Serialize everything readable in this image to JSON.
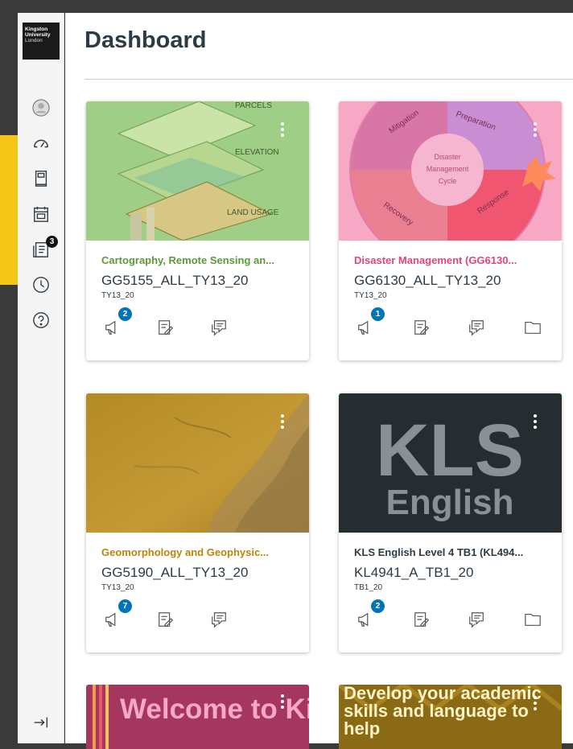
{
  "logo": {
    "line1": "Kingston",
    "line2": "University",
    "line3": "London"
  },
  "nav": {
    "items": [
      "account-icon",
      "dashboard-icon",
      "courses-icon",
      "calendar-icon",
      "inbox-icon",
      "history-icon",
      "help-icon"
    ],
    "inbox_badge": "3",
    "collapse_icon": "collapse-icon"
  },
  "page": {
    "title": "Dashboard"
  },
  "cards": [
    {
      "title": "Cartography, Remote Sensing an...",
      "code": "GG5155_ALL_TY13_20",
      "term": "TY13_20",
      "badge": "2",
      "color": "#5a9a3a",
      "hero_labels": [
        "PARCELS",
        "ELEVATION",
        "LAND USAGE"
      ]
    },
    {
      "title": "Disaster Management (GG6130...",
      "code": "GG6130_ALL_TY13_20",
      "term": "TY13_20",
      "badge": "1",
      "color": "#e0457b",
      "hero_labels": [
        "Mitigation",
        "Preparation",
        "Disaster Management Cycle",
        "Recovery",
        "Response"
      ]
    },
    {
      "title": "Geomorphology and Geophysic...",
      "code": "GG5190_ALL_TY13_20",
      "term": "TY13_20",
      "badge": "7",
      "color": "#b8860b"
    },
    {
      "title": "KLS English Level 4 TB1 (KL494...",
      "code": "KL4941_A_TB1_20",
      "term": "TB1_20",
      "badge": "2",
      "color": "#2d3b45",
      "hero_labels": [
        "KLS",
        "English"
      ]
    }
  ],
  "partial_cards": [
    {
      "text": "Welcome to Kingston"
    },
    {
      "text": "Develop your academic skills and language to help"
    }
  ],
  "colors": {
    "accent": "#f5c518",
    "badge_blue": "#0374b5"
  }
}
